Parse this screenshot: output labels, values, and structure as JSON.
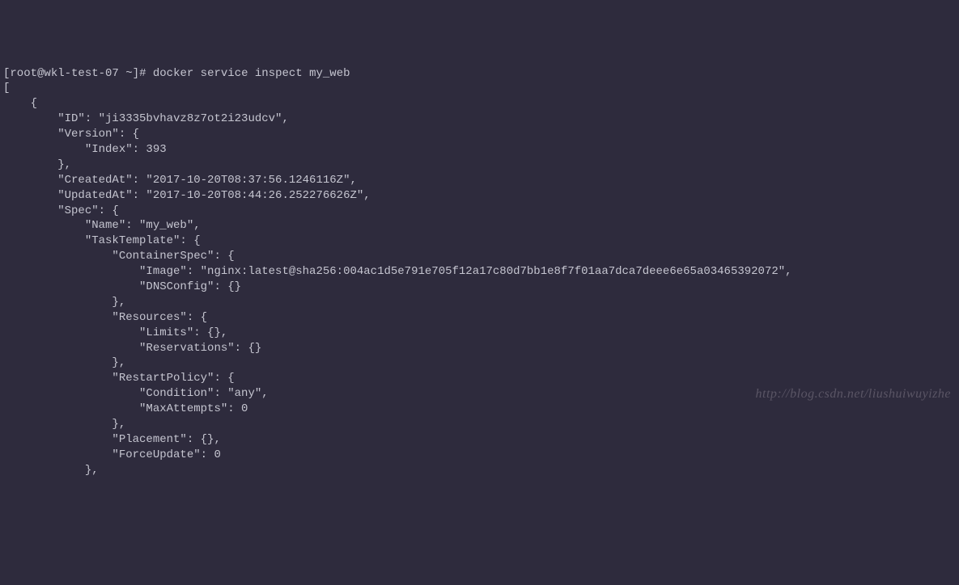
{
  "prompt": {
    "user": "root",
    "host": "wkl-test-07",
    "path": "~",
    "symbol": "#"
  },
  "command": "docker service inspect my_web",
  "output": {
    "line_open_bracket": "[",
    "line_open_brace": "    {",
    "line_id": "        \"ID\": \"ji3335bvhavz8z7ot2i23udcv\",",
    "line_version_open": "        \"Version\": {",
    "line_index": "            \"Index\": 393",
    "line_version_close": "        },",
    "line_created": "        \"CreatedAt\": \"2017-10-20T08:37:56.1246116Z\",",
    "line_updated": "        \"UpdatedAt\": \"2017-10-20T08:44:26.252276626Z\",",
    "line_spec_open": "        \"Spec\": {",
    "line_name": "            \"Name\": \"my_web\",",
    "line_tasktemplate_open": "            \"TaskTemplate\": {",
    "line_containerspec_open": "                \"ContainerSpec\": {",
    "line_image": "                    \"Image\": \"nginx:latest@sha256:004ac1d5e791e705f12a17c80d7bb1e8f7f01aa7dca7deee6e65a03465392072\",",
    "line_dnsconfig": "                    \"DNSConfig\": {}",
    "line_containerspec_close": "                },",
    "line_resources_open": "                \"Resources\": {",
    "line_limits": "                    \"Limits\": {},",
    "line_reservations": "                    \"Reservations\": {}",
    "line_resources_close": "                },",
    "line_restartpolicy_open": "                \"RestartPolicy\": {",
    "line_condition": "                    \"Condition\": \"any\",",
    "line_maxattempts": "                    \"MaxAttempts\": 0",
    "line_restartpolicy_close": "                },",
    "line_placement": "                \"Placement\": {},",
    "line_forceupdate": "                \"ForceUpdate\": 0",
    "line_tasktemplate_close": "            },"
  },
  "watermark": "http://blog.csdn.net/liushuiwuyizhe"
}
